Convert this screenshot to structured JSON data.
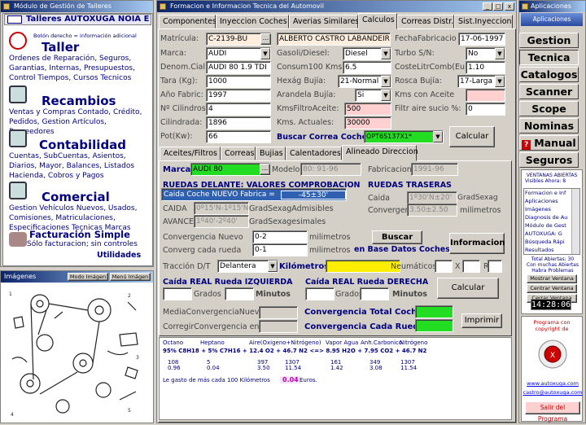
{
  "left_window": {
    "title": "Módulo de Gestión de Talleres",
    "header": "Talleres AUTOXUGA NOIA E",
    "hint": "Botón derecho = información adicional",
    "sections": [
      {
        "title": "Taller",
        "desc": "Ordenes de Reparación, Seguros, Garantias, Internas, Presupuestos, Control Tiempos, Cursos Tecnicos",
        "icon": "clock-icon"
      },
      {
        "title": "Recambios",
        "desc": "Ventas y Compras Contado, Crédito, Pedidos, Gestion Artículos, Proveedores",
        "icon": "parts-icon"
      },
      {
        "title": "Contabilidad",
        "desc": "Cuentas, SubCuentas, Asientos, Diarios, Mayor, Balances, Listados Hacienda, Cobros y Pagos",
        "icon": "coins-icon"
      },
      {
        "title": "Comercial",
        "desc": "Gestion Vehículos Nuevos, Usados, Comisiones, Matriculaciones, Especificaciones Tecnicas Marcas",
        "icon": "book-icon"
      }
    ],
    "fact_title": "Facturación Simple",
    "fact_desc": "Sólo facturacion; sin controles",
    "utilidades": "Utilidades"
  },
  "img_window": {
    "title": "Imágenes",
    "mode_btn": "Modo Imágen",
    "menu_btn": "Menú Imágen"
  },
  "main": {
    "title": "Formacion e Informacion Tecnica del Automovil",
    "tabs": [
      "Componentes",
      "Inyeccion Coches",
      "Averias Similares",
      "Calculos",
      "Correas Distr.",
      "Sist.Inyeccion"
    ],
    "f": {
      "matricula_l": "Matrícula:",
      "matricula": "C-2139-BU",
      "owner": "ALBERTO CASTRO LABANDEIR",
      "fechafab_l": "FechaFabricacio",
      "fechafab": "17-06-1997",
      "marca_l": "Marca:",
      "marca": "AUDI",
      "gasoil_l": "Gasoli/Diesel:",
      "gasoil": "Diesel",
      "turbo_l": "Turbo S/N:",
      "turbo": "No",
      "denom_l": "Denom.Cial:",
      "denom": "AUDI 80 1.9 TDI",
      "consum_l": "Consum100 Kms:",
      "consum": "6.5",
      "coste_l": "CosteLitrComb(Eu)",
      "coste": "1.10",
      "tara_l": "Tara (Kg):",
      "tara": "1000",
      "hexag_l": "Hexág Bujía:",
      "hexag": "21-Normal",
      "rosca_l": "Rosca Bujía:",
      "rosca": "17-Larga",
      "anio_l": "Año Fabric:",
      "anio": "1997",
      "arand_l": "Arandela Bujía:",
      "arand": "Si",
      "kmsac_l": "Kms con Aceite",
      "kmsac": "",
      "cil_l": "Nº Cilindros:",
      "cil": "4",
      "kmsfil_l": "KmsFiltroAceite:",
      "kmsfil": "500",
      "filtr_l": "Filtr aire sucio %:",
      "filtr": "0",
      "cilin_l": "Cilindrada:",
      "cilin": "1896",
      "kmsact_l": "Kms. Actuales:",
      "kmsact": "30000",
      "pot_l": "Pot(Kw):",
      "pot": "66",
      "buscar_correa_l": "Buscar Correa Coche",
      "correa": "OPT6S137X1*",
      "calcular": "Calcular"
    },
    "subtabs": [
      "Aceites/Filtros",
      "Correas",
      "Bujias",
      "Calentadores",
      "Alineado Direccion"
    ],
    "a": {
      "marca_l": "Marca",
      "marca": "AUDI 80",
      "modelo_l": "Modelo",
      "modelo": "80:  91-96",
      "fab_l": "Fabricacion",
      "fab": "1991-96",
      "delante_t": "RUEDAS DELANTE: VALORES COMPROBACION",
      "caida_nuevo": "Caida Coche NUEVO Fabrica =",
      "caida_nuevo_v": "-45±30'",
      "caida_l": "CAIDA",
      "caida_v": "0º15'N-1º15'N",
      "caida_u": "GradSexagAdmisibles",
      "avance_l": "AVANCE",
      "avance_v": "1º40'-2º40'",
      "avance_u": "GradSexagesimales",
      "traseras_t": "RUEDAS TRASERAS",
      "tcaida_l": "Caida",
      "tcaida_v": "1º30'N±20'",
      "tcaida_u": "GradSexag",
      "tconv_l": "Converger",
      "tconv_v": "3.50±2.50",
      "tconv_u": "milimetros",
      "conv_nuevo_l": "Convergencia Nuevo",
      "conv_nuevo": "0-2",
      "conv_u": "milimetros",
      "conv_cada_l": "Converg cada rueda",
      "conv_cada": "0-1",
      "conv_cada_u": "milimetros",
      "buscar": "Buscar",
      "bd": "en Base Datos Coches",
      "informacion": "Informacion",
      "traccion_l": "Tracción D/T",
      "traccion": "Delantera",
      "km_l": "Kilómetros",
      "neum_l": "Neumáticos",
      "x": "X",
      "r": "R",
      "izq_t": "Caída REAL Rueda IZQUIERDA",
      "der_t": "Caída REAL Rueda DERECHA",
      "grados": "Grados",
      "minutos": "Minutos",
      "calcular": "Calcular",
      "media_l": "MediaConvergenciaNuevo",
      "corregir_l": "CorregirConvergencia en",
      "total_l": "Convergencia Total Coche",
      "cada_l": "Convergencia Cada Rueda",
      "imprimir": "Imprimir"
    },
    "fuel": {
      "headers": [
        "Octano",
        "Heptano",
        "Aire(Oxigeno+Nitrógeno)",
        "Vapor Agua",
        "Anh.Carbonico",
        "Nitrógeno"
      ],
      "formula": "95% C8H18 + 5% C7H16 + 12.4 O2 + 46.7 N2 <=> 8.95 H2O + 7.95 CO2 + 46.7 N2",
      "row1": [
        "108",
        "5",
        "397",
        "1307",
        "161",
        "349",
        "1307"
      ],
      "row2": [
        "0.96",
        "0.04",
        "3.50",
        "11.54",
        "1.42",
        "3.08",
        "11.54"
      ],
      "gasto_l": "Le gasto de más cada 100 Kilómetros",
      "gasto": "0.04",
      "gasto_u": "Euros."
    }
  },
  "right": {
    "title": "Aplicaciones",
    "header": "Aplicaciones",
    "buttons": [
      "Gestion",
      "Tecnica",
      "Catalogos",
      "Scanner",
      "Scope",
      "Nominas",
      "Manual",
      "Seguros"
    ],
    "vent_t": "VENTANAS ABIERTAS",
    "vent_v": "Visibles Ahora: 8",
    "list": [
      "Formacion e Inf",
      "Aplicaciones",
      "Imágenes",
      "Diagnosis de Au",
      "Módulo de Gest",
      "AUTOXUGA: G",
      "Búsqueda Rápi",
      "Resultados"
    ],
    "total": "Total Abiertas: 30",
    "muchas": "Con muchas Abiertas",
    "hab": "Habra Problemas",
    "mostrar": "Mostrar Ventana",
    "centrar": "Centrar Ventana",
    "cerrar": "Cerrar Ventana",
    "clock": "14:28:06",
    "prog": "Programa con copyright de",
    "web": "www.autoxuga.com",
    "mail": "castro@autoxuga.com",
    "salir": "Salir del Programa"
  }
}
